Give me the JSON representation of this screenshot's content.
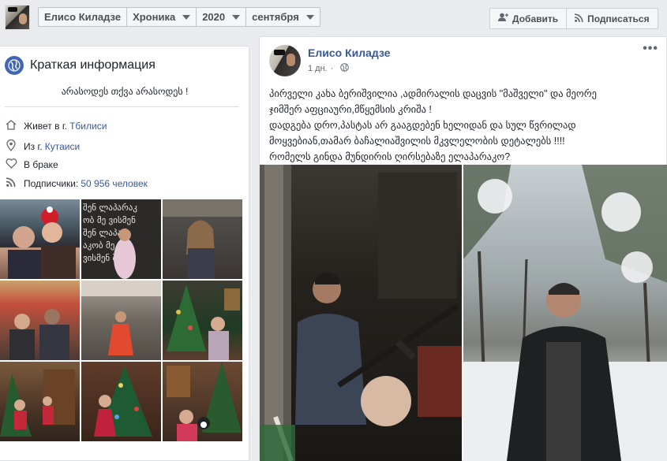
{
  "topbar": {
    "name_filter": "Елисо Киладзе",
    "section_filter": "Хроника",
    "year_filter": "2020",
    "month_filter": "сентября",
    "add_button": "Добавить",
    "subscribe_button": "Подписаться"
  },
  "intro": {
    "title": "Краткая информация",
    "bio": "არასოდეს თქვა არასოდეს !",
    "lives_prefix": "Живет в г. ",
    "lives_city": "Тбилиси",
    "from_prefix": "Из г. ",
    "from_city": "Кутаиси",
    "relationship": "В браке",
    "followers_prefix": "Подписчики: ",
    "followers_count": "50 956 человек",
    "photo_note_overlay": "შენ ლაპარაკობ მე ვისმენ"
  },
  "post": {
    "author": "Елисо Киладзе",
    "time": "1 дн.",
    "dot": "·",
    "more": "•••",
    "text_lines": [
      "პირველი კახა ბერიშვილია ,ადმირალის დაცვის \"მაშველი\" და მეორე",
      "ჯიმშერ აფციაური,მწყემსის კრიშა !",
      "დადგება დრო,პასტას არ გააგდებენ ხელიდან და სულ წვრილად",
      "მოყვებიან,თამარ ბაჩალიაშვილის მკვლელობის დეტალებს !!!!",
      "რომელს გინდა მუნდირის ღირსებაზე ელაპარაკო?"
    ]
  },
  "colors": {
    "link": "#385898",
    "background": "#e9ebee",
    "card": "#ffffff",
    "accent": "#4267b2"
  }
}
